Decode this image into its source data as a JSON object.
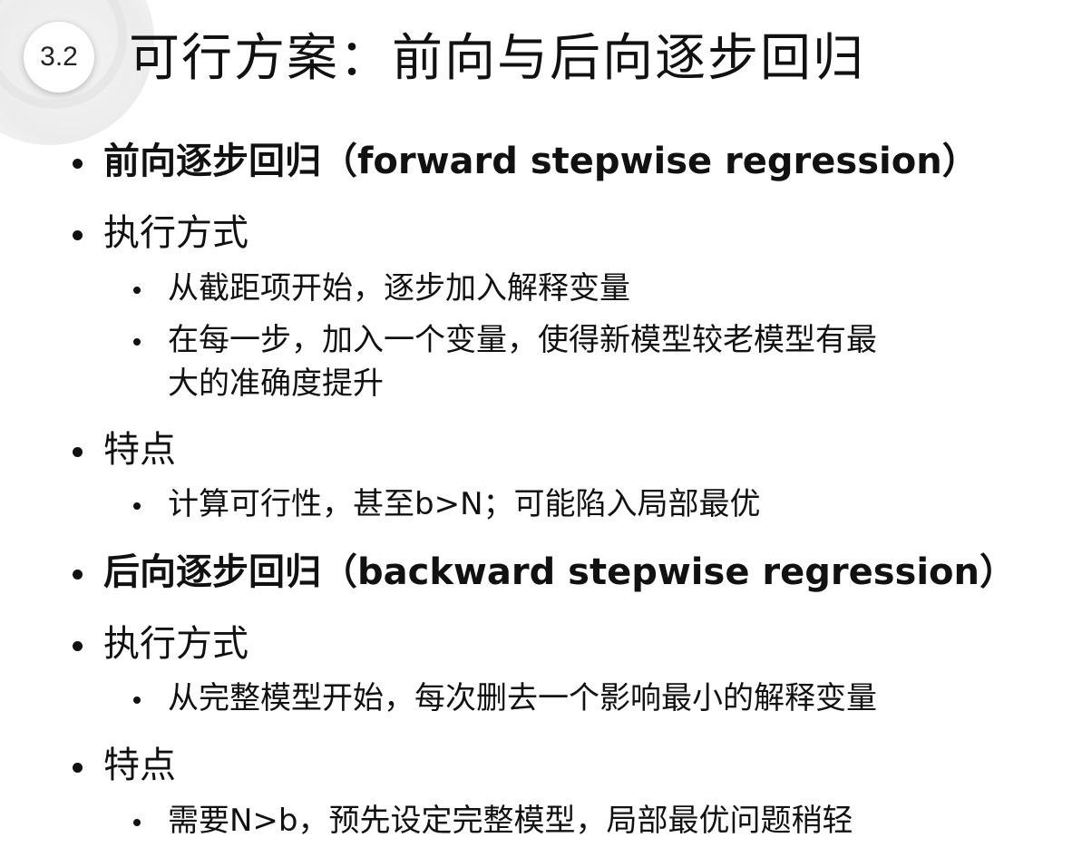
{
  "slide": {
    "number": "3.2",
    "title": "可行方案：前向与后向逐步回归"
  },
  "items": [
    {
      "level": 1,
      "bold": true,
      "text": "前向逐步回归（forward stepwise regression）"
    },
    {
      "level": 1,
      "bold": false,
      "text": "执行方式"
    },
    {
      "level": 2,
      "bold": false,
      "text": "从截距项开始，逐步加入解释变量"
    },
    {
      "level": 2,
      "bold": false,
      "text": "在每一步，加入一个变量，使得新模型较老模型有最"
    },
    {
      "level": 2,
      "bold": false,
      "text": "大的准确度提升",
      "continuation": true
    },
    {
      "level": 1,
      "bold": false,
      "text": "特点"
    },
    {
      "level": 2,
      "bold": false,
      "text": "计算可行性，甚至b>N；可能陷入局部最优"
    },
    {
      "level": 1,
      "bold": true,
      "text": "后向逐步回归（backward stepwise regression）"
    },
    {
      "level": 1,
      "bold": false,
      "text": "执行方式"
    },
    {
      "level": 2,
      "bold": false,
      "text": "从完整模型开始，每次删去一个影响最小的解释变量"
    },
    {
      "level": 1,
      "bold": false,
      "text": "特点"
    },
    {
      "level": 2,
      "bold": false,
      "text": "需要N>b，预先设定完整模型，局部最优问题稍轻"
    }
  ]
}
